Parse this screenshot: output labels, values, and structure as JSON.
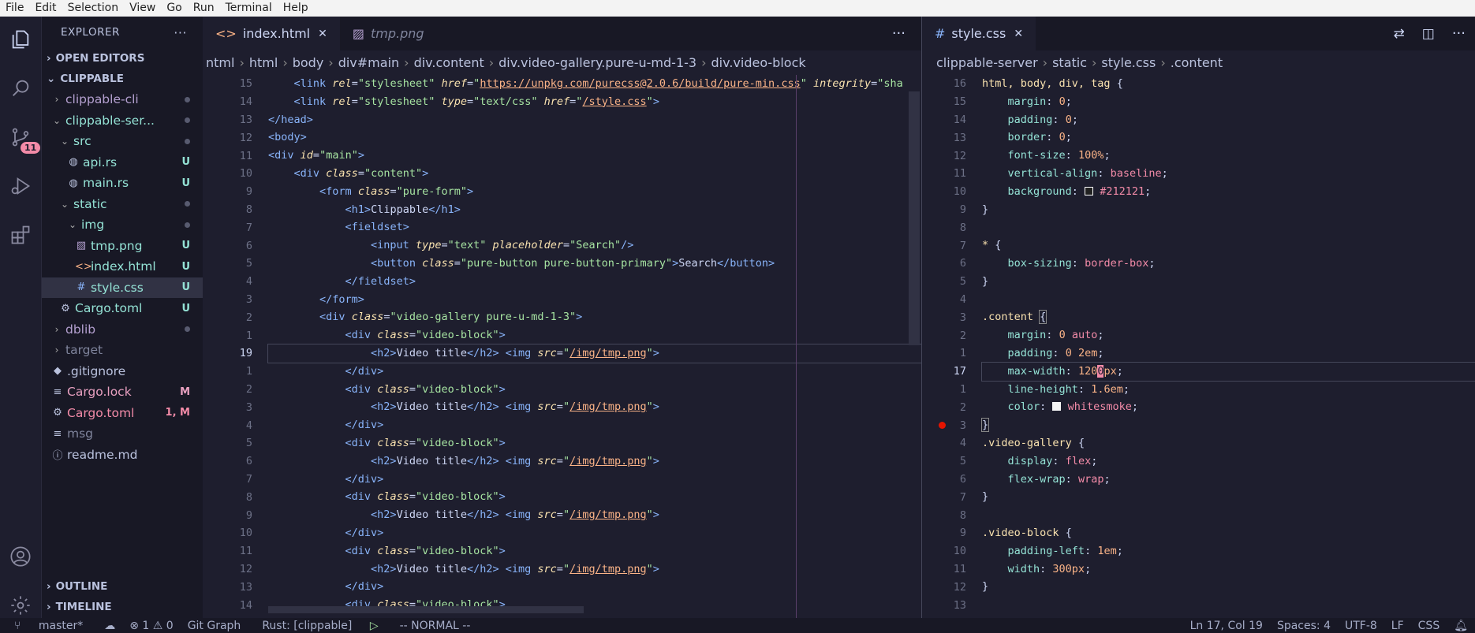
{
  "menu": [
    "File",
    "Edit",
    "Selection",
    "View",
    "Go",
    "Run",
    "Terminal",
    "Help"
  ],
  "activity": {
    "scm_badge": "11"
  },
  "explorer": {
    "title": "EXPLORER",
    "open_editors": "OPEN EDITORS",
    "root": "CLIPPABLE",
    "items": [
      {
        "label": "clippable-cli",
        "status": "",
        "indent": 1,
        "type": "folder-closed",
        "color": "#b4a0d0"
      },
      {
        "label": "clippable-ser...",
        "status": "",
        "indent": 1,
        "type": "folder-open",
        "color": "#94e2d5"
      },
      {
        "label": "src",
        "status": "",
        "indent": 2,
        "type": "folder-open",
        "color": "#94e2d5"
      },
      {
        "label": "api.rs",
        "status": "U",
        "indent": 3,
        "type": "rust",
        "color": "#94e2d5"
      },
      {
        "label": "main.rs",
        "status": "U",
        "indent": 3,
        "type": "rust",
        "color": "#94e2d5"
      },
      {
        "label": "static",
        "status": "",
        "indent": 2,
        "type": "folder-open",
        "color": "#94e2d5"
      },
      {
        "label": "img",
        "status": "",
        "indent": 3,
        "type": "folder-open",
        "color": "#94e2d5"
      },
      {
        "label": "tmp.png",
        "status": "U",
        "indent": 4,
        "type": "image",
        "color": "#94e2d5"
      },
      {
        "label": "index.html",
        "status": "U",
        "indent": 4,
        "type": "html",
        "color": "#94e2d5"
      },
      {
        "label": "style.css",
        "status": "U",
        "indent": 4,
        "type": "css",
        "color": "#94e2d5"
      },
      {
        "label": "Cargo.toml",
        "status": "U",
        "indent": 2,
        "type": "gear",
        "color": "#94e2d5"
      },
      {
        "label": "dblib",
        "status": "",
        "indent": 1,
        "type": "folder-closed",
        "color": "#b4a0d0"
      },
      {
        "label": "target",
        "status": "",
        "indent": 1,
        "type": "folder-closed",
        "color": "#7f849c"
      },
      {
        "label": ".gitignore",
        "status": "",
        "indent": 1,
        "type": "git",
        "color": "#bac2de"
      },
      {
        "label": "Cargo.lock",
        "status": "M",
        "indent": 1,
        "type": "lines",
        "color": "#e8a0c0"
      },
      {
        "label": "Cargo.toml",
        "status": "1, M",
        "indent": 1,
        "type": "gear",
        "color": "#f38ba8"
      },
      {
        "label": "msg",
        "status": "",
        "indent": 1,
        "type": "lines",
        "color": "#7f849c"
      },
      {
        "label": "readme.md",
        "status": "",
        "indent": 1,
        "type": "info",
        "color": "#bac2de"
      }
    ],
    "outline": "OUTLINE",
    "timeline": "TIMELINE"
  },
  "editor1": {
    "tabs": [
      {
        "label": "index.html"
      },
      {
        "label": "tmp.png"
      }
    ],
    "breadcrumbs": [
      "ntml",
      "html",
      "body",
      "div#main",
      "div.content",
      "div.video-gallery.pure-u-md-1-3",
      "div.video-block"
    ],
    "lines": [
      {
        "n": "15",
        "html": "    <span class=\"t-tag\">&lt;link</span> <span class=\"t-attr\">rel</span>=<span class=\"t-str\">\"stylesheet\"</span> <span class=\"t-attr\">href</span>=<span class=\"t-str\">\"</span><span class=\"t-strl\">https://unpkg.com/purecss@2.0.6/build/pure-min.css</span><span class=\"t-str\">\"</span> <span class=\"t-attr\">integrity</span>=<span class=\"t-str\">\"sha</span>"
      },
      {
        "n": "14",
        "html": "    <span class=\"t-tag\">&lt;link</span> <span class=\"t-attr\">rel</span>=<span class=\"t-str\">\"stylesheet\"</span> <span class=\"t-attr\">type</span>=<span class=\"t-str\">\"text/css\"</span> <span class=\"t-attr\">href</span>=<span class=\"t-str\">\"</span><span class=\"t-strl\">/style.css</span><span class=\"t-str\">\"</span><span class=\"t-tag\">&gt;</span>"
      },
      {
        "n": "13",
        "html": "<span class=\"t-tag\">&lt;/head&gt;</span>"
      },
      {
        "n": "12",
        "html": "<span class=\"t-tag\">&lt;body&gt;</span>"
      },
      {
        "n": "11",
        "html": "<span class=\"t-tag\">&lt;div</span> <span class=\"t-attr\">id</span>=<span class=\"t-str\">\"main\"</span><span class=\"t-tag\">&gt;</span>"
      },
      {
        "n": "10",
        "html": "    <span class=\"t-tag\">&lt;div</span> <span class=\"t-attr\">class</span>=<span class=\"t-str\">\"content\"</span><span class=\"t-tag\">&gt;</span>"
      },
      {
        "n": "9",
        "html": "        <span class=\"t-tag\">&lt;form</span> <span class=\"t-attr\">class</span>=<span class=\"t-str\">\"pure-form\"</span><span class=\"t-tag\">&gt;</span>"
      },
      {
        "n": "8",
        "html": "            <span class=\"t-tag\">&lt;h1&gt;</span><span class=\"t-pl\">Clippable</span><span class=\"t-tag\">&lt;/h1&gt;</span>"
      },
      {
        "n": "7",
        "html": "            <span class=\"t-tag\">&lt;fieldset&gt;</span>"
      },
      {
        "n": "6",
        "html": "                <span class=\"t-tag\">&lt;input</span> <span class=\"t-attr\">type</span>=<span class=\"t-str\">\"text\"</span> <span class=\"t-attr\">placeholder</span>=<span class=\"t-str\">\"Search\"</span><span class=\"t-tag\">/&gt;</span>"
      },
      {
        "n": "5",
        "html": "                <span class=\"t-tag\">&lt;button</span> <span class=\"t-attr\">class</span>=<span class=\"t-str\">\"pure-button pure-button-primary\"</span><span class=\"t-tag\">&gt;</span><span class=\"t-pl\">Search</span><span class=\"t-tag\">&lt;/button&gt;</span>"
      },
      {
        "n": "4",
        "html": "            <span class=\"t-tag\">&lt;/fieldset&gt;</span>"
      },
      {
        "n": "3",
        "html": "        <span class=\"t-tag\">&lt;/form&gt;</span>"
      },
      {
        "n": "2",
        "html": "        <span class=\"t-tag\">&lt;div</span> <span class=\"t-attr\">class</span>=<span class=\"t-str\">\"video-gallery pure-u-md-1-3\"</span><span class=\"t-tag\">&gt;</span>"
      },
      {
        "n": "1",
        "html": "            <span class=\"t-tag\">&lt;div</span> <span class=\"t-attr\">class</span>=<span class=\"t-str\">\"video-block\"</span><span class=\"t-tag\">&gt;</span>"
      },
      {
        "n": "19",
        "cur": true,
        "html": "                <span class=\"t-tag\">&lt;h2&gt;</span><span class=\"t-pl\">Video title</span><span class=\"t-tag\">&lt;/h2&gt;</span> <span class=\"t-tag\">&lt;img</span> <span class=\"t-attr\">src</span>=<span class=\"t-str\">\"</span><span class=\"t-strl\">/img/tmp.png</span><span class=\"t-str\">\"</span><span class=\"t-tag\">&gt;</span>"
      },
      {
        "n": "1",
        "html": "            <span class=\"t-tag\">&lt;/div&gt;</span>"
      },
      {
        "n": "2",
        "html": "            <span class=\"t-tag\">&lt;div</span> <span class=\"t-attr\">class</span>=<span class=\"t-str\">\"video-block\"</span><span class=\"t-tag\">&gt;</span>"
      },
      {
        "n": "3",
        "html": "                <span class=\"t-tag\">&lt;h2&gt;</span><span class=\"t-pl\">Video title</span><span class=\"t-tag\">&lt;/h2&gt;</span> <span class=\"t-tag\">&lt;img</span> <span class=\"t-attr\">src</span>=<span class=\"t-str\">\"</span><span class=\"t-strl\">/img/tmp.png</span><span class=\"t-str\">\"</span><span class=\"t-tag\">&gt;</span>"
      },
      {
        "n": "4",
        "html": "            <span class=\"t-tag\">&lt;/div&gt;</span>"
      },
      {
        "n": "5",
        "html": "            <span class=\"t-tag\">&lt;div</span> <span class=\"t-attr\">class</span>=<span class=\"t-str\">\"video-block\"</span><span class=\"t-tag\">&gt;</span>"
      },
      {
        "n": "6",
        "html": "                <span class=\"t-tag\">&lt;h2&gt;</span><span class=\"t-pl\">Video title</span><span class=\"t-tag\">&lt;/h2&gt;</span> <span class=\"t-tag\">&lt;img</span> <span class=\"t-attr\">src</span>=<span class=\"t-str\">\"</span><span class=\"t-strl\">/img/tmp.png</span><span class=\"t-str\">\"</span><span class=\"t-tag\">&gt;</span>"
      },
      {
        "n": "7",
        "html": "            <span class=\"t-tag\">&lt;/div&gt;</span>"
      },
      {
        "n": "8",
        "html": "            <span class=\"t-tag\">&lt;div</span> <span class=\"t-attr\">class</span>=<span class=\"t-str\">\"video-block\"</span><span class=\"t-tag\">&gt;</span>"
      },
      {
        "n": "9",
        "html": "                <span class=\"t-tag\">&lt;h2&gt;</span><span class=\"t-pl\">Video title</span><span class=\"t-tag\">&lt;/h2&gt;</span> <span class=\"t-tag\">&lt;img</span> <span class=\"t-attr\">src</span>=<span class=\"t-str\">\"</span><span class=\"t-strl\">/img/tmp.png</span><span class=\"t-str\">\"</span><span class=\"t-tag\">&gt;</span>"
      },
      {
        "n": "10",
        "html": "            <span class=\"t-tag\">&lt;/div&gt;</span>"
      },
      {
        "n": "11",
        "html": "            <span class=\"t-tag\">&lt;div</span> <span class=\"t-attr\">class</span>=<span class=\"t-str\">\"video-block\"</span><span class=\"t-tag\">&gt;</span>"
      },
      {
        "n": "12",
        "html": "                <span class=\"t-tag\">&lt;h2&gt;</span><span class=\"t-pl\">Video title</span><span class=\"t-tag\">&lt;/h2&gt;</span> <span class=\"t-tag\">&lt;img</span> <span class=\"t-attr\">src</span>=<span class=\"t-str\">\"</span><span class=\"t-strl\">/img/tmp.png</span><span class=\"t-str\">\"</span><span class=\"t-tag\">&gt;</span>"
      },
      {
        "n": "13",
        "html": "            <span class=\"t-tag\">&lt;/div&gt;</span>"
      },
      {
        "n": "14",
        "html": "            <span class=\"t-tag\">&lt;div</span> <span class=\"t-attr\">class</span>=<span class=\"t-str\">\"video-block\"</span><span class=\"t-tag\">&gt;</span>"
      }
    ]
  },
  "editor2": {
    "tab": "style.css",
    "breadcrumbs": [
      "clippable-server",
      "static",
      "style.css",
      ".content"
    ],
    "lines": [
      {
        "n": "16",
        "html": "<span class=\"t-sel\">html, body, div, tag</span> <span class=\"t-brace\">{</span>"
      },
      {
        "n": "15",
        "html": "    <span class=\"t-prop\">margin</span>: <span class=\"t-num\">0</span>;"
      },
      {
        "n": "14",
        "html": "    <span class=\"t-prop\">padding</span>: <span class=\"t-num\">0</span>;"
      },
      {
        "n": "13",
        "html": "    <span class=\"t-prop\">border</span>: <span class=\"t-num\">0</span>;"
      },
      {
        "n": "12",
        "html": "    <span class=\"t-prop\">font-size</span>: <span class=\"t-num\">100%</span>;"
      },
      {
        "n": "11",
        "html": "    <span class=\"t-prop\">vertical-align</span>: <span class=\"t-val\">baseline</span>;"
      },
      {
        "n": "10",
        "html": "    <span class=\"t-prop\">background</span>: <span style=\"display:inline-block;width:11px;height:11px;border:1px solid #fff;background:#212121;vertical-align:-1px\"></span> <span class=\"t-val\">#212121</span>;"
      },
      {
        "n": "9",
        "html": "<span class=\"t-brace\">}</span>"
      },
      {
        "n": "8",
        "html": ""
      },
      {
        "n": "7",
        "html": "<span class=\"t-sel\">*</span> <span class=\"t-brace\">{</span>"
      },
      {
        "n": "6",
        "html": "    <span class=\"t-prop\">box-sizing</span>: <span class=\"t-val\">border-box</span>;"
      },
      {
        "n": "5",
        "html": "<span class=\"t-brace\">}</span>"
      },
      {
        "n": "4",
        "html": ""
      },
      {
        "n": "3",
        "html": "<span class=\"t-sel\">.content</span> <span class=\"t-brace\" style=\"outline:1px solid #888\">{</span>"
      },
      {
        "n": "2",
        "html": "    <span class=\"t-prop\">margin</span>: <span class=\"t-num\">0</span> <span class=\"t-val\">auto</span>;"
      },
      {
        "n": "1",
        "html": "    <span class=\"t-prop\">padding</span>: <span class=\"t-num\">0 2em</span>;"
      },
      {
        "n": "17",
        "cur": true,
        "html": "    <span class=\"t-prop\">max-width</span>: <span class=\"t-num\">120</span><span style=\"background:#f38ba8;color:#1e1e2e\">0</span><span class=\"t-num\">px</span>;"
      },
      {
        "n": "1",
        "html": "    <span class=\"t-prop\">line-height</span>: <span class=\"t-num\">1.6em</span>;"
      },
      {
        "n": "2",
        "html": "    <span class=\"t-prop\">color</span>: <span style=\"display:inline-block;width:11px;height:11px;background:#f5f5f5;vertical-align:-1px\"></span> <span class=\"t-val\">whitesmoke</span>;"
      },
      {
        "n": "3",
        "bp": true,
        "html": "<span class=\"t-brace\" style=\"outline:1px solid #888\">}</span>"
      },
      {
        "n": "4",
        "html": "<span class=\"t-sel\">.video-gallery</span> <span class=\"t-brace\">{</span>"
      },
      {
        "n": "5",
        "html": "    <span class=\"t-prop\">display</span>: <span class=\"t-val\">flex</span>;"
      },
      {
        "n": "6",
        "html": "    <span class=\"t-prop\">flex-wrap</span>: <span class=\"t-val\">wrap</span>;"
      },
      {
        "n": "7",
        "html": "<span class=\"t-brace\">}</span>"
      },
      {
        "n": "8",
        "html": ""
      },
      {
        "n": "9",
        "html": "<span class=\"t-sel\">.video-block</span> <span class=\"t-brace\">{</span>"
      },
      {
        "n": "10",
        "html": "    <span class=\"t-prop\">padding-left</span>: <span class=\"t-num\">1em</span>;"
      },
      {
        "n": "11",
        "html": "    <span class=\"t-prop\">width</span>: <span class=\"t-num\">300px</span>;"
      },
      {
        "n": "12",
        "html": "<span class=\"t-brace\">}</span>"
      },
      {
        "n": "13",
        "html": ""
      }
    ]
  },
  "status": {
    "branch": "master*",
    "problems": "⊗ 1 ⚠ 0",
    "git_graph": "Git Graph",
    "rust": "Rust: [clippable]",
    "mode": "-- NORMAL --",
    "position": "Ln 17, Col 19",
    "spaces": "Spaces: 4",
    "encoding": "UTF-8",
    "eol": "LF",
    "language": "CSS"
  }
}
